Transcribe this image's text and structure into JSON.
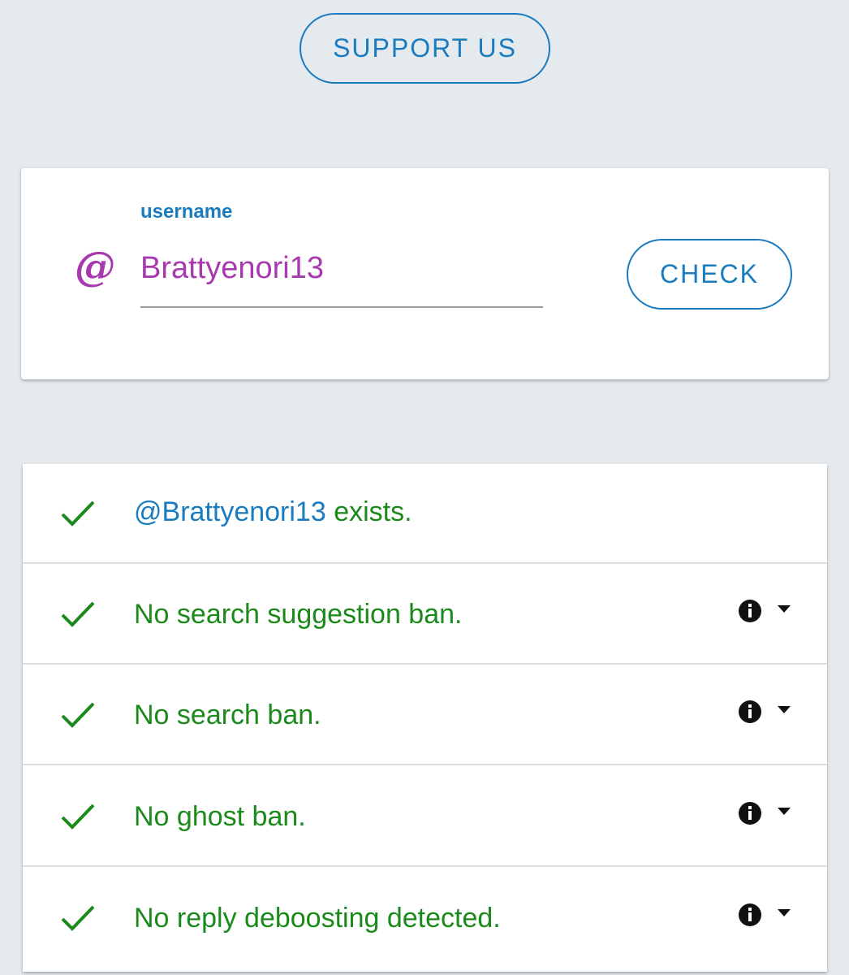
{
  "header": {
    "support_label": "SUPPORT US"
  },
  "search": {
    "field_label": "username",
    "at_symbol": "@",
    "value": "Brattyenori13",
    "check_label": "CHECK"
  },
  "results": [
    {
      "icon": "check-icon",
      "handle": "@Brattyenori13",
      "text": " exists.",
      "has_info": false
    },
    {
      "icon": "check-icon",
      "text": "No search suggestion ban.",
      "has_info": true
    },
    {
      "icon": "check-icon",
      "text": "No search ban.",
      "has_info": true
    },
    {
      "icon": "check-icon",
      "text": "No ghost ban.",
      "has_info": true
    },
    {
      "icon": "check-icon",
      "text": "No reply deboosting detected.",
      "has_info": true
    }
  ],
  "colors": {
    "accent": "#1a7bbf",
    "username": "#a63aae",
    "success": "#1b8a1b",
    "background": "#e5eaee"
  }
}
